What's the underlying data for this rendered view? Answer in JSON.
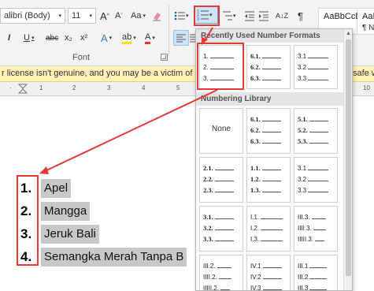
{
  "ribbon": {
    "font_name": "alibri (Body)",
    "font_size": "11",
    "grow_font": "A",
    "shrink_font": "A",
    "change_case": "Aa",
    "bold": "I",
    "underline": "U",
    "strike": "abc",
    "subscript": "x₂",
    "superscript": "x²",
    "text_effects": "A",
    "highlight": "ab",
    "font_color": "A",
    "font_group_label": "Font",
    "sort": "A↓Z",
    "pilcrow": "¶",
    "styles": [
      {
        "preview": "AaBbCcDc",
        "name": ""
      },
      {
        "preview": "AaB",
        "name": "¶ No"
      }
    ]
  },
  "notification": {
    "text": "r license isn't genuine, and you may be a victim of software c",
    "tail": "safe w"
  },
  "ruler": {
    "marks": [
      "1",
      "2",
      "3",
      "4",
      "5"
    ],
    "right_mark": "10"
  },
  "document": {
    "items": [
      {
        "num": "1.",
        "text": "Apel"
      },
      {
        "num": "2.",
        "text": "Mangga"
      },
      {
        "num": "3.",
        "text": "Jeruk Bali"
      },
      {
        "num": "4.",
        "text": "Semangka Merah Tanpa B"
      }
    ]
  },
  "gallery": {
    "recent_header": "Recently Used Number Formats",
    "library_header": "Numbering Library",
    "recent": [
      [
        "1.",
        "2.",
        "3."
      ],
      [
        "6.1.",
        "6.2.",
        "6.3."
      ],
      [
        "3.1",
        "3.2",
        "3.3"
      ]
    ],
    "none_label": "None",
    "library_row1": [
      [
        "6.1.",
        "6.2.",
        "6.3."
      ],
      [
        "5.1.",
        "5.2.",
        "5.3."
      ]
    ],
    "library_row2": [
      [
        "2.1.",
        "2.2.",
        "2.3."
      ],
      [
        "1.1.",
        "1.2.",
        "1.3."
      ],
      [
        "3.1",
        "3.2",
        "3.3"
      ]
    ],
    "library_row3": [
      [
        "3.1.",
        "3.2.",
        "3.3."
      ],
      [
        "I.1.",
        "I.2.",
        "I.3."
      ],
      [
        "III.3.",
        "IIII.3.",
        "IIIII.3."
      ]
    ],
    "library_row4": [
      [
        "III.2.",
        "IIII.2.",
        "IIIII.2."
      ],
      [
        "IV.1",
        "IV.2",
        "IV.3"
      ],
      [
        "III.1",
        "III.2",
        "III.3"
      ]
    ]
  },
  "colors": {
    "annotation_red": "#e53935",
    "selection_gray": "#c8c8c8",
    "notification_yellow": "#fff1b8",
    "numbering_button_blue": "#cfe3f7"
  }
}
